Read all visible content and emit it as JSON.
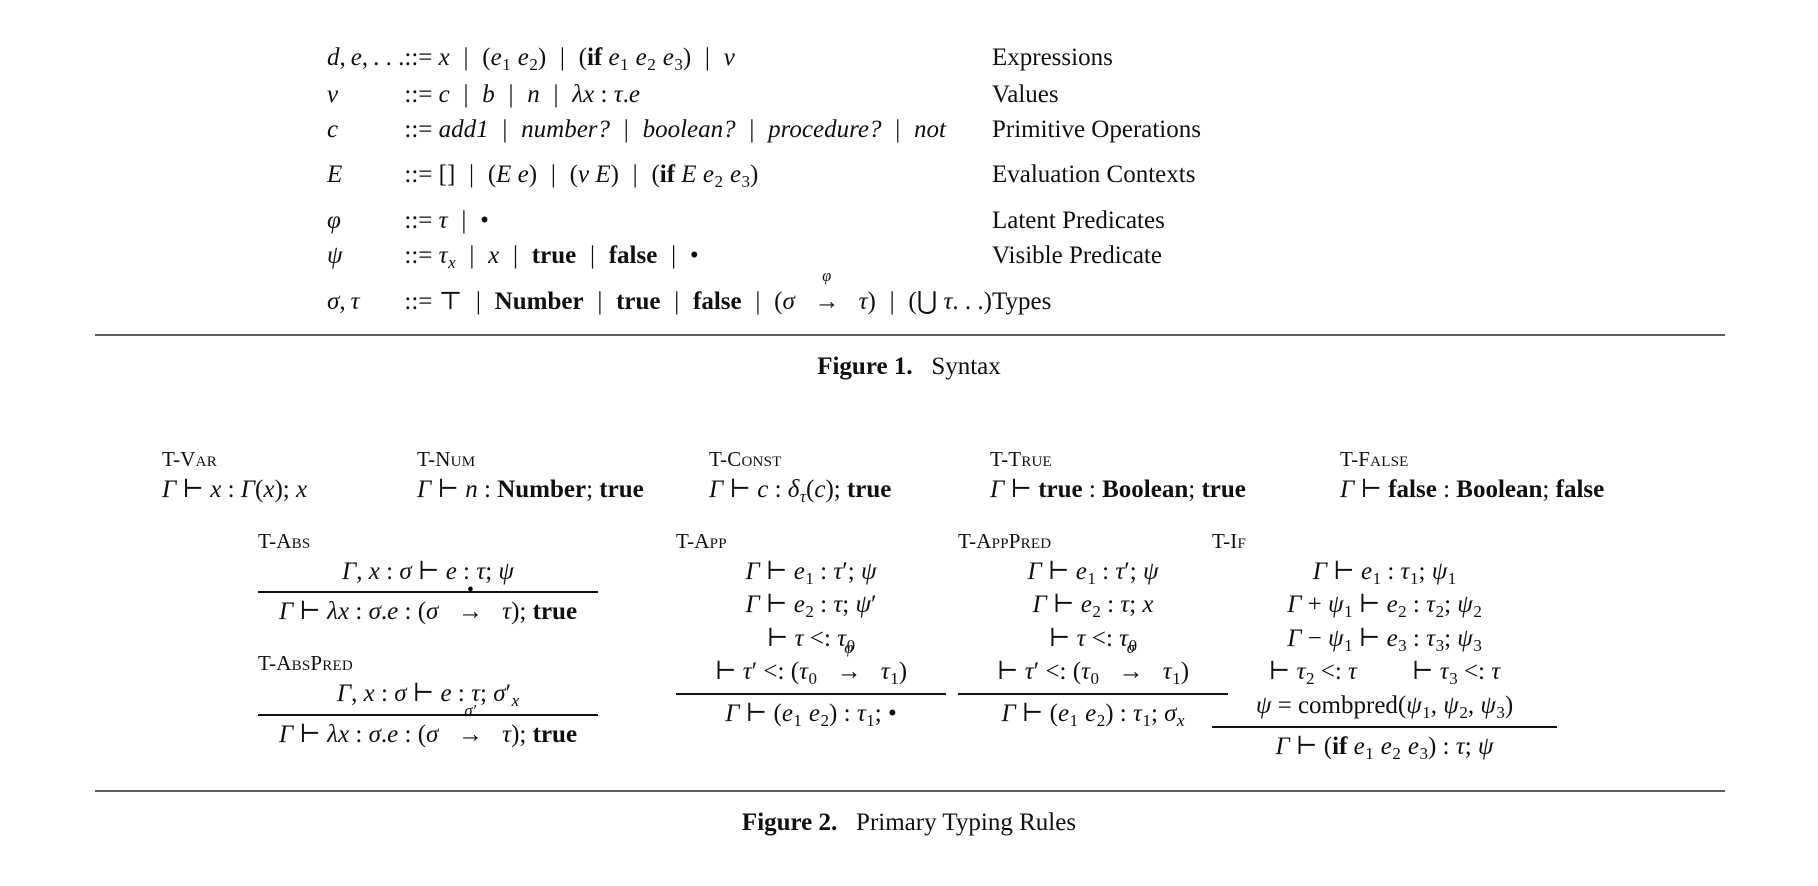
{
  "figure1": {
    "caption_label": "Figure 1.",
    "caption_text": "Syntax",
    "rows": [
      {
        "nonterminal": "d, e, . . .",
        "definition": "x  |  (e1 e2)  |  (if e1 e2 e3)  |  v",
        "name": "Expressions"
      },
      {
        "nonterminal": "v",
        "definition": "c  |  b  |  n  |  λx : τ.e",
        "name": "Values"
      },
      {
        "nonterminal": "c",
        "definition": "add1  |  number?  |  boolean?  |  procedure?  |  not",
        "name": "Primitive Operations"
      },
      {
        "nonterminal": "E",
        "definition": "[]  |  (E e)  |  (v E)  |  (if E e2 e3)",
        "name": "Evaluation Contexts"
      },
      {
        "nonterminal": "ϕ",
        "definition": "τ  |  •",
        "name": "Latent Predicates"
      },
      {
        "nonterminal": "ψ",
        "definition": "τx  |  x  |  true  |  false  |  •",
        "name": "Visible Predicate"
      },
      {
        "nonterminal": "σ, τ",
        "definition": "⊤  |  Number  |  true  |  false  |  (σ →ϕ τ)  |  (⋃ τ . . .)",
        "name": "Types"
      }
    ],
    "defines_symbol": "::="
  },
  "figure2": {
    "caption_label": "Figure 2.",
    "caption_text": "Primary Typing Rules",
    "rules": [
      {
        "name": "T-Var",
        "premises": [],
        "conclusion": "Γ ⊢ x : Γ(x); x"
      },
      {
        "name": "T-Num",
        "premises": [],
        "conclusion": "Γ ⊢ n : Number; true"
      },
      {
        "name": "T-Const",
        "premises": [],
        "conclusion": "Γ ⊢ c : δτ(c); true"
      },
      {
        "name": "T-True",
        "premises": [],
        "conclusion": "Γ ⊢ true : Boolean; true"
      },
      {
        "name": "T-False",
        "premises": [],
        "conclusion": "Γ ⊢ false : Boolean; false"
      },
      {
        "name": "T-Abs",
        "premises": [
          "Γ, x : σ ⊢ e : τ; ψ"
        ],
        "conclusion": "Γ ⊢ λx : σ.e : (σ →• τ); true"
      },
      {
        "name": "T-AbsPred",
        "premises": [
          "Γ, x : σ ⊢ e : τ; σ′x"
        ],
        "conclusion": "Γ ⊢ λx : σ.e : (σ →σ′ τ); true"
      },
      {
        "name": "T-App",
        "premises": [
          "Γ ⊢ e1 : τ′; ψ",
          "Γ ⊢ e2 : τ; ψ′",
          "⊢ τ <: τ0",
          "⊢ τ′ <: (τ0 →ϕ τ1)"
        ],
        "conclusion": "Γ ⊢ (e1 e2) : τ1; •"
      },
      {
        "name": "T-AppPred",
        "premises": [
          "Γ ⊢ e1 : τ′; ψ",
          "Γ ⊢ e2 : τ; x",
          "⊢ τ <: τ0",
          "⊢ τ′ <: (τ0 →σ τ1)"
        ],
        "conclusion": "Γ ⊢ (e1 e2) : τ1; σx"
      },
      {
        "name": "T-If",
        "premises": [
          "Γ ⊢ e1 : τ1; ψ1",
          "Γ + ψ1 ⊢ e2 : τ2; ψ2",
          "Γ − ψ1 ⊢ e3 : τ3; ψ3",
          "⊢ τ2 <: τ     ⊢ τ3 <: τ",
          "ψ = combpred(ψ1, ψ2, ψ3)"
        ],
        "conclusion": "Γ ⊢ (if e1 e2 e3) : τ; ψ"
      }
    ]
  }
}
